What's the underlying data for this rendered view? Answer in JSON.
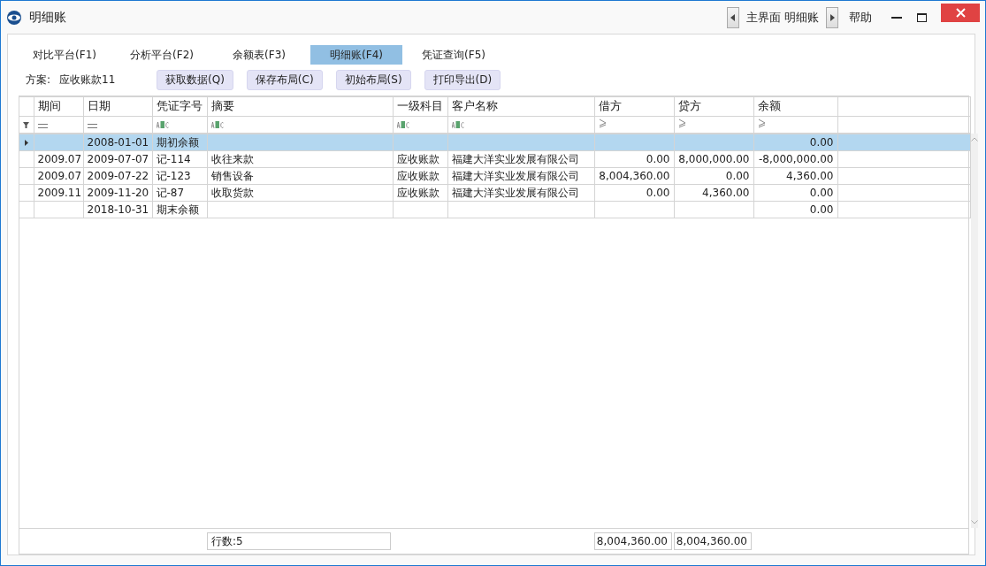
{
  "window": {
    "title": "明细账"
  },
  "title_bar": {
    "nav_label": "主界面 明细账",
    "help": "帮助"
  },
  "tabs": [
    {
      "label": "对比平台(F1)",
      "selected": false
    },
    {
      "label": "分析平台(F2)",
      "selected": false
    },
    {
      "label": "余额表(F3)",
      "selected": false
    },
    {
      "label": "明细账(F4)",
      "selected": true
    },
    {
      "label": "凭证查询(F5)",
      "selected": false
    }
  ],
  "toolbar": {
    "scheme_label": "方案:",
    "scheme_value": "应收账款11",
    "buttons": [
      "获取数据(Q)",
      "保存布局(C)",
      "初始布局(S)",
      "打印导出(D)"
    ]
  },
  "table": {
    "columns": [
      {
        "label": "期间",
        "kind": "equals"
      },
      {
        "label": "日期",
        "kind": "equals"
      },
      {
        "label": "凭证字号",
        "kind": "text"
      },
      {
        "label": "摘要",
        "kind": "text"
      },
      {
        "label": "一级科目",
        "kind": "text"
      },
      {
        "label": "客户名称",
        "kind": "text"
      },
      {
        "label": "借方",
        "kind": "number"
      },
      {
        "label": "贷方",
        "kind": "number"
      },
      {
        "label": "余额",
        "kind": "number"
      }
    ],
    "rows": [
      {
        "selected": true,
        "date": "2008-01-01",
        "voucher": "期初余额",
        "balance": "0.00"
      },
      {
        "selected": false,
        "period": "2009.07",
        "date": "2009-07-07",
        "voucher": "记-114",
        "summary": "收往来款",
        "account": "应收账款",
        "customer": "福建大洋实业发展有限公司",
        "debit": "0.00",
        "credit": "8,000,000.00",
        "balance": "-8,000,000.00"
      },
      {
        "selected": false,
        "period": "2009.07",
        "date": "2009-07-22",
        "voucher": "记-123",
        "summary": "销售设备",
        "account": "应收账款",
        "customer": "福建大洋实业发展有限公司",
        "debit": "8,004,360.00",
        "credit": "0.00",
        "balance": "4,360.00"
      },
      {
        "selected": false,
        "period": "2009.11",
        "date": "2009-11-20",
        "voucher": "记-87",
        "summary": "收取货款",
        "account": "应收账款",
        "customer": "福建大洋实业发展有限公司",
        "debit": "0.00",
        "credit": "4,360.00",
        "balance": "0.00"
      },
      {
        "selected": false,
        "date": "2018-10-31",
        "voucher": "期末余额",
        "balance": "0.00"
      }
    ],
    "footer": {
      "row_count": "行数:5",
      "debit_total": "8,004,360.00",
      "credit_total": "8,004,360.00"
    }
  }
}
